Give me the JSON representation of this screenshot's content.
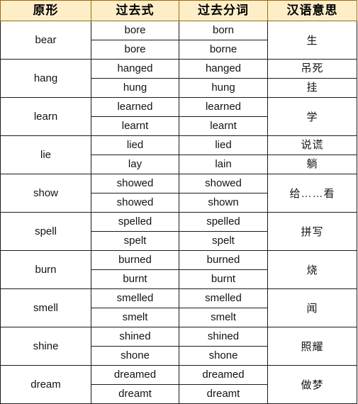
{
  "table": {
    "headers": [
      {
        "label": "原形",
        "key": "base"
      },
      {
        "label": "过去式",
        "key": "past"
      },
      {
        "label": "过去分词",
        "key": "participle"
      },
      {
        "label": "汉语意思",
        "key": "meaning"
      }
    ],
    "style": {
      "header_background": "#fdeec8",
      "header_border": "#9f6a12",
      "body_border": "#1b1b1b",
      "body_background": "#ffffff",
      "text_color": "#131313"
    },
    "rows": [
      {
        "base": "bear",
        "forms": [
          {
            "past": "bore",
            "participle": "born"
          },
          {
            "past": "bore",
            "participle": "borne"
          }
        ],
        "meanings": [
          "生"
        ],
        "meaning_merged": true
      },
      {
        "base": "hang",
        "forms": [
          {
            "past": "hanged",
            "participle": "hanged"
          },
          {
            "past": "hung",
            "participle": "hung"
          }
        ],
        "meanings": [
          "吊死",
          "挂"
        ],
        "meaning_merged": false
      },
      {
        "base": "learn",
        "forms": [
          {
            "past": "learned",
            "participle": "learned"
          },
          {
            "past": "learnt",
            "participle": "learnt"
          }
        ],
        "meanings": [
          "学"
        ],
        "meaning_merged": true
      },
      {
        "base": "lie",
        "forms": [
          {
            "past": "lied",
            "participle": "lied"
          },
          {
            "past": "lay",
            "participle": "lain"
          }
        ],
        "meanings": [
          "说谎",
          "躺"
        ],
        "meaning_merged": false
      },
      {
        "base": "show",
        "forms": [
          {
            "past": "showed",
            "participle": "showed"
          },
          {
            "past": "showed",
            "participle": "shown"
          }
        ],
        "meanings": [
          "给……看"
        ],
        "meaning_merged": true
      },
      {
        "base": "spell",
        "forms": [
          {
            "past": "spelled",
            "participle": "spelled"
          },
          {
            "past": "spelt",
            "participle": "spelt"
          }
        ],
        "meanings": [
          "拼写"
        ],
        "meaning_merged": true
      },
      {
        "base": "burn",
        "forms": [
          {
            "past": "burned",
            "participle": "burned"
          },
          {
            "past": "burnt",
            "participle": "burnt"
          }
        ],
        "meanings": [
          "烧"
        ],
        "meaning_merged": true
      },
      {
        "base": "smell",
        "forms": [
          {
            "past": "smelled",
            "participle": "smelled"
          },
          {
            "past": "smelt",
            "participle": "smelt"
          }
        ],
        "meanings": [
          "闻"
        ],
        "meaning_merged": true
      },
      {
        "base": "shine",
        "forms": [
          {
            "past": "shined",
            "participle": "shined"
          },
          {
            "past": "shone",
            "participle": "shone"
          }
        ],
        "meanings": [
          "照耀"
        ],
        "meaning_merged": true
      },
      {
        "base": "dream",
        "forms": [
          {
            "past": "dreamed",
            "participle": "dreamed"
          },
          {
            "past": "dreamt",
            "participle": "dreamt"
          }
        ],
        "meanings": [
          "做梦"
        ],
        "meaning_merged": true
      }
    ]
  }
}
